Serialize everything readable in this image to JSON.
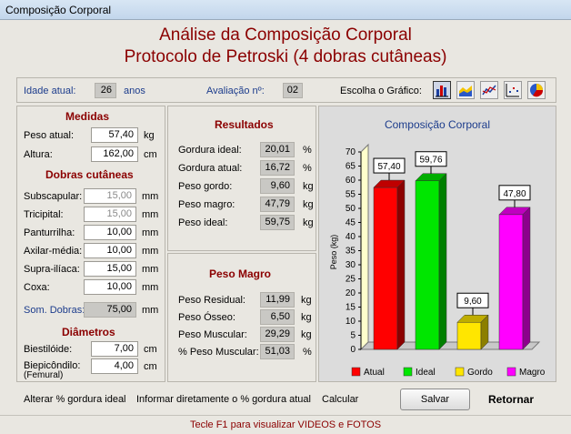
{
  "window": {
    "title": "Composição Corporal"
  },
  "header": {
    "title": "Análise da Composição Corporal",
    "subtitle": "Protocolo de Petroski (4 dobras cutâneas)"
  },
  "info": {
    "idade_label": "Idade atual:",
    "idade_value": "26",
    "idade_unit": "anos",
    "avaliacao_label": "Avaliação nº:",
    "avaliacao_value": "02",
    "grafico_label": "Escolha o Gráfico:"
  },
  "chart_icons": [
    "bar-chart-icon",
    "area-chart-icon",
    "line-chart-icon",
    "scatter-chart-icon",
    "pie-chart-icon"
  ],
  "medidas": {
    "title": "Medidas",
    "peso_label": "Peso atual:",
    "peso_value": "57,40",
    "peso_unit": "kg",
    "altura_label": "Altura:",
    "altura_value": "162,00",
    "altura_unit": "cm"
  },
  "dobras": {
    "title": "Dobras cutâneas",
    "items": [
      {
        "label": "Subscapular:",
        "value": "15,00",
        "unit": "mm"
      },
      {
        "label": "Tricipital:",
        "value": "15,00",
        "unit": "mm"
      },
      {
        "label": "Panturrilha:",
        "value": "10,00",
        "unit": "mm"
      },
      {
        "label": "Axilar-média:",
        "value": "10,00",
        "unit": "mm"
      },
      {
        "label": "Supra-ilíaca:",
        "value": "15,00",
        "unit": "mm"
      },
      {
        "label": "Coxa:",
        "value": "10,00",
        "unit": "mm"
      }
    ],
    "soma_label": "Som. Dobras:",
    "soma_value": "75,00",
    "soma_unit": "mm"
  },
  "diametros": {
    "title": "Diâmetros",
    "biestiloide_label": "Biestilóide:",
    "biestiloide_value": "7,00",
    "biestiloide_unit": "cm",
    "biepicondilo_label": "Biepicôndilo:",
    "biepicondilo_sub": "(Femural)",
    "biepicondilo_value": "4,00",
    "biepicondilo_unit": "cm"
  },
  "resultados": {
    "title": "Resultados",
    "items": [
      {
        "label": "Gordura ideal:",
        "value": "20,01",
        "unit": "%"
      },
      {
        "label": "Gordura atual:",
        "value": "16,72",
        "unit": "%"
      },
      {
        "label": "Peso gordo:",
        "value": "9,60",
        "unit": "kg"
      },
      {
        "label": "Peso magro:",
        "value": "47,79",
        "unit": "kg"
      },
      {
        "label": "Peso ideal:",
        "value": "59,75",
        "unit": "kg"
      }
    ]
  },
  "peso_magro": {
    "title": "Peso Magro",
    "items": [
      {
        "label": "Peso Residual:",
        "value": "11,99",
        "unit": "kg"
      },
      {
        "label": "Peso Ósseo:",
        "value": "6,50",
        "unit": "kg"
      },
      {
        "label": "Peso Muscular:",
        "value": "29,29",
        "unit": "kg"
      },
      {
        "label": "% Peso Muscular:",
        "value": "51,03",
        "unit": "%"
      }
    ]
  },
  "footer": {
    "link1": "Alterar % gordura ideal",
    "link2": "Informar diretamente o % gordura atual",
    "link3": "Calcular",
    "save": "Salvar",
    "back": "Retornar",
    "hint": "Tecle F1 para visualizar VIDEOS e FOTOS"
  },
  "colors": {
    "accent": "#8b0000",
    "chart_title": "#1c3c8c",
    "chart_bg": "#dcdcdc"
  },
  "chart_data": {
    "type": "bar",
    "title": "Composição Corporal",
    "ylabel": "Peso (kg)",
    "ylim": [
      0,
      70
    ],
    "yticks": [
      "0",
      "5",
      "10",
      "15",
      "20",
      "25",
      "30",
      "35",
      "40",
      "45",
      "50",
      "55",
      "60",
      "65",
      "70"
    ],
    "categories": [
      "Atual",
      "Ideal",
      "Gordo",
      "Magro"
    ],
    "values": [
      57.4,
      59.76,
      9.6,
      47.8
    ],
    "labels": [
      "57,40",
      "59,76",
      "9,60",
      "47,80"
    ],
    "colors": [
      "#ff0000",
      "#00e600",
      "#ffe600",
      "#ff00ff"
    ],
    "legend_position": "bottom"
  }
}
